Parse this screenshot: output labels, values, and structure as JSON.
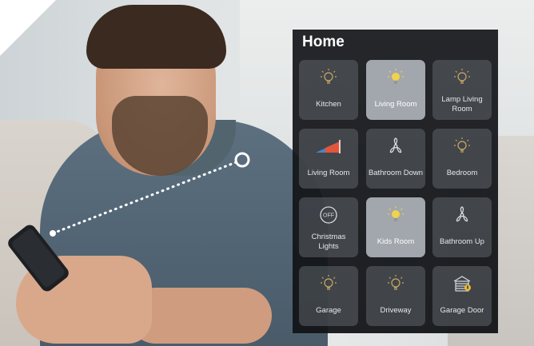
{
  "panel": {
    "title": "Home"
  },
  "tiles": [
    {
      "label": "Kitchen",
      "icon": "bulb-icon",
      "state": "off"
    },
    {
      "label": "Living Room",
      "icon": "bulb-icon",
      "state": "on"
    },
    {
      "label": "Lamp Living Room",
      "icon": "bulb-icon",
      "state": "off"
    },
    {
      "label": "Living Room",
      "icon": "dimmer-icon",
      "state": "off"
    },
    {
      "label": "Bathroom Down",
      "icon": "fan-icon",
      "state": "off"
    },
    {
      "label": "Bedroom",
      "icon": "bulb-icon",
      "state": "off"
    },
    {
      "label": "Christmas Lights",
      "icon": "power-off-icon",
      "state": "off"
    },
    {
      "label": "Kids Room",
      "icon": "bulb-icon",
      "state": "on"
    },
    {
      "label": "Bathroom Up",
      "icon": "fan-icon",
      "state": "off"
    },
    {
      "label": "Garage",
      "icon": "bulb-icon",
      "state": "off"
    },
    {
      "label": "Driveway",
      "icon": "bulb-icon",
      "state": "off"
    },
    {
      "label": "Garage Door",
      "icon": "garage-door-icon",
      "state": "off"
    }
  ],
  "icons": {
    "power_off_text": "OFF"
  },
  "colors": {
    "bulb_on": "#f2d24a",
    "bulb_off": "#c9a863",
    "dimmer_accent": "#e1563b",
    "dimmer_base": "#4e8fd6",
    "garage_badge": "#e7b93a"
  }
}
